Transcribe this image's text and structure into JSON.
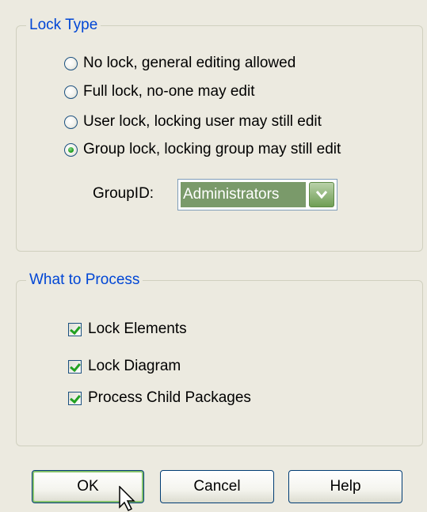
{
  "lock_type": {
    "title": "Lock Type",
    "options": [
      {
        "label": "No lock, general editing allowed",
        "checked": false
      },
      {
        "label": "Full lock, no-one may edit",
        "checked": false
      },
      {
        "label": "User lock, locking user may still edit",
        "checked": false
      },
      {
        "label": "Group lock, locking group may still edit",
        "checked": true
      }
    ],
    "group_id_label": "GroupID:",
    "group_id_value": "Administrators"
  },
  "process": {
    "title": "What to Process",
    "options": [
      {
        "label": "Lock Elements",
        "checked": true
      },
      {
        "label": "Lock Diagram",
        "checked": true
      },
      {
        "label": "Process Child Packages",
        "checked": true
      }
    ]
  },
  "buttons": {
    "ok": "OK",
    "cancel": "Cancel",
    "help": "Help"
  },
  "icons": {
    "dropdown": "chevron-down-icon",
    "cursor": "mouse-pointer-icon"
  },
  "colors": {
    "group_title": "#0046d5",
    "accent_green": "#21a121",
    "selection": "#7a9a6a"
  }
}
